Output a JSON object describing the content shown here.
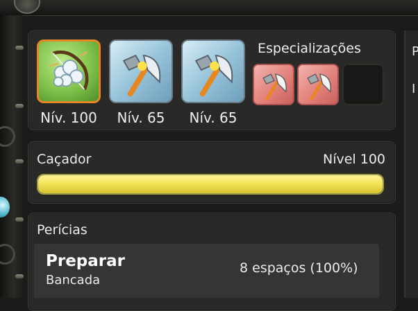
{
  "right_edge": {
    "letter_1": "P",
    "letter_2": "I"
  },
  "tools": [
    {
      "icon": "crystal-bow-icon",
      "level_label": "Nív. 100"
    },
    {
      "icon": "axe-hammer-icon",
      "level_label": "Nív. 65"
    },
    {
      "icon": "axe-hammer-icon",
      "level_label": "Nív. 65"
    }
  ],
  "specializations": {
    "title": "Especializações",
    "items": [
      {
        "icon": "axe-hammer-icon"
      },
      {
        "icon": "axe-hammer-icon"
      },
      {
        "icon": "empty-slot"
      }
    ]
  },
  "job": {
    "name": "Caçador",
    "level_label": "Nível 100",
    "progress": 1.0,
    "bar_color": "#f2e45a"
  },
  "skills": {
    "title": "Perícias",
    "items": [
      {
        "name": "Preparar",
        "station": "Bancada",
        "slots": "8 espaços (100%)"
      }
    ]
  },
  "colors": {
    "accent_orange": "#e58725",
    "panel": "#292927"
  }
}
